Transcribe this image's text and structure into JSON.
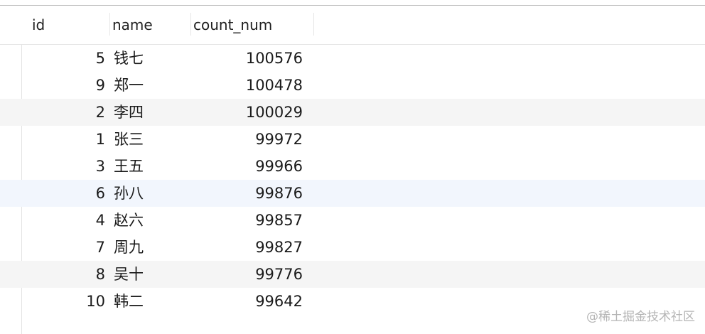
{
  "table": {
    "columns": [
      {
        "key": "id",
        "label": "id"
      },
      {
        "key": "name",
        "label": "name"
      },
      {
        "key": "count_num",
        "label": "count_num"
      }
    ],
    "rows": [
      {
        "id": "5",
        "name": "钱七",
        "count_num": "100576",
        "state": "normal"
      },
      {
        "id": "9",
        "name": "郑一",
        "count_num": "100478",
        "state": "normal"
      },
      {
        "id": "2",
        "name": "李四",
        "count_num": "100029",
        "state": "striped"
      },
      {
        "id": "1",
        "name": "张三",
        "count_num": "99972",
        "state": "normal"
      },
      {
        "id": "3",
        "name": "王五",
        "count_num": "99966",
        "state": "normal"
      },
      {
        "id": "6",
        "name": "孙八",
        "count_num": "99876",
        "state": "selected"
      },
      {
        "id": "4",
        "name": "赵六",
        "count_num": "99857",
        "state": "normal"
      },
      {
        "id": "7",
        "name": "周九",
        "count_num": "99827",
        "state": "normal"
      },
      {
        "id": "8",
        "name": "吴十",
        "count_num": "99776",
        "state": "striped"
      },
      {
        "id": "10",
        "name": "韩二",
        "count_num": "99642",
        "state": "normal"
      }
    ]
  },
  "watermark": "@稀土掘金技术社区",
  "colors": {
    "stripe": "#f5f5f5",
    "selected": "#f2f6fd",
    "text": "#1a1a1a"
  }
}
